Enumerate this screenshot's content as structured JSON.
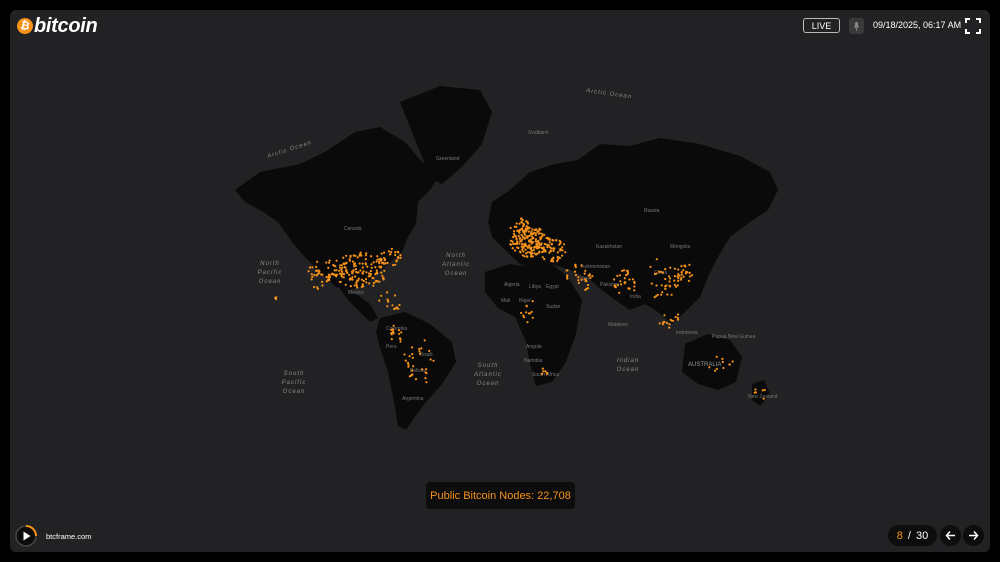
{
  "header": {
    "logo_text": "bitcoin",
    "logo_symbol": "₿",
    "live_label": "LIVE",
    "datetime": "09/18/2025, 06:17 AM"
  },
  "map": {
    "ocean_labels": [
      {
        "lines": [
          "Arctic Ocean"
        ]
      },
      {
        "lines": [
          "Arctic Ocean"
        ]
      },
      {
        "lines": [
          "North",
          "Pacific",
          "Ocean"
        ]
      },
      {
        "lines": [
          "North",
          "Atlantic",
          "Ocean"
        ]
      },
      {
        "lines": [
          "South",
          "Pacific",
          "Ocean"
        ]
      },
      {
        "lines": [
          "South",
          "Atlantic",
          "Ocean"
        ]
      },
      {
        "lines": [
          "Indian",
          "Ocean"
        ]
      }
    ],
    "country_labels": [
      "Greenland",
      "Canada",
      "Russia",
      "Kazakhstan",
      "China",
      "Algeria",
      "Libya",
      "Egypt",
      "Mali",
      "Niger",
      "Sudan",
      "Angola",
      "Namibia",
      "South Africa",
      "Brazil",
      "Argentina",
      "Peru",
      "Colombia",
      "Mexico",
      "AUSTRALIA",
      "Turkmenistan",
      "Pakistan",
      "India",
      "Iran",
      "Mongolia",
      "Indonesia",
      "Papua New Guinea",
      "New Zealand",
      "Svalbard",
      "Maldives",
      "Bolivia"
    ],
    "node_color": "#f7931a"
  },
  "tooltip": {
    "text": "Public Bitcoin Nodes: 22,708"
  },
  "footer": {
    "site": "btcframe.com",
    "page_current": "8",
    "page_separator": "/",
    "page_total": "30"
  },
  "colors": {
    "accent": "#f7931a",
    "background": "#222224",
    "land": "#0a0a0a"
  }
}
